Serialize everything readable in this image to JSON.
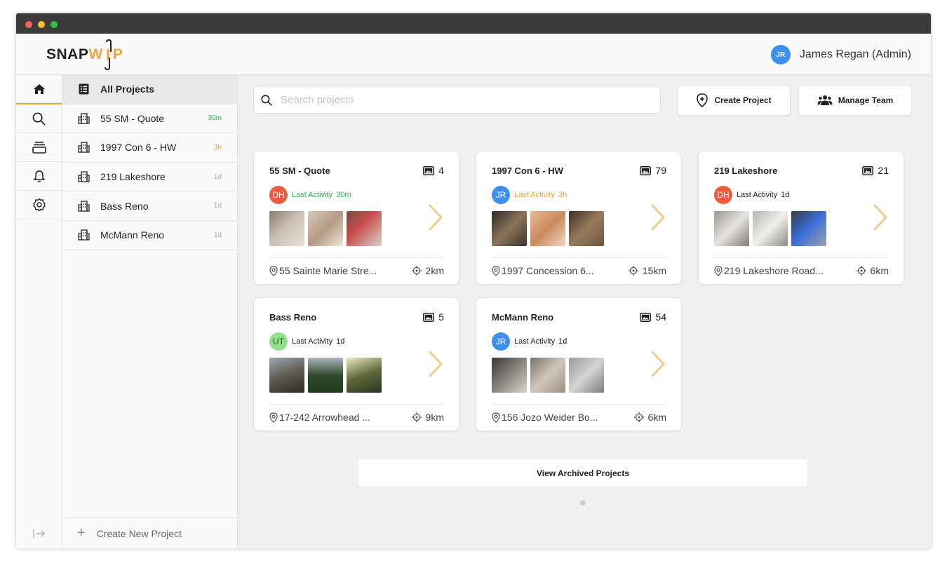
{
  "app": {
    "logo_left": "SNAP",
    "logo_right_w": "W",
    "logo_right_p": "P"
  },
  "user": {
    "initials": "JR",
    "name": "James Regan (Admin)",
    "color": "#3d8ef0"
  },
  "rail": [
    "home-icon",
    "search-icon",
    "projects-icon",
    "bell-icon",
    "settings-icon"
  ],
  "sidebar": {
    "all_projects": "All Projects",
    "items": [
      {
        "label": "55 SM - Quote",
        "time": "30m",
        "time_color": "#2db34a"
      },
      {
        "label": "1997 Con 6 - HW",
        "time": "3h",
        "time_color": "#f2a33a"
      },
      {
        "label": "219 Lakeshore",
        "time": "1d",
        "time_color": "#aaaaaa"
      },
      {
        "label": "Bass Reno",
        "time": "1d",
        "time_color": "#aaaaaa"
      },
      {
        "label": "McMann Reno",
        "time": "1d",
        "time_color": "#aaaaaa"
      }
    ],
    "create": "Create New Project"
  },
  "search": {
    "placeholder": "Search projects"
  },
  "buttons": {
    "create_project": "Create Project",
    "manage_team": "Manage Team"
  },
  "cards": [
    {
      "title": "55 SM - Quote",
      "count": "4",
      "initials": "DH",
      "avatar_color": "#ef5a3c",
      "activity_label": "Last Activity",
      "activity_time": "30m",
      "activity_color": "#2db34a",
      "address": "55 Sainte Marie Stre...",
      "distance": "2km"
    },
    {
      "title": "1997 Con 6 - HW",
      "count": "79",
      "initials": "JR",
      "avatar_color": "#3d8ef0",
      "activity_label": "Last Activity",
      "activity_time": "3h",
      "activity_color": "#f2a33a",
      "address": "1997 Concession 6...",
      "distance": "15km"
    },
    {
      "title": "219 Lakeshore",
      "count": "21",
      "initials": "DH",
      "avatar_color": "#ef5a3c",
      "activity_label": "Last Activity",
      "activity_time": "1d",
      "activity_color": "#222222",
      "address": "219 Lakeshore Road...",
      "distance": "6km"
    },
    {
      "title": "Bass Reno",
      "count": "5",
      "initials": "UT",
      "avatar_color": "#8fe08a",
      "activity_label": "Last Activity",
      "activity_time": "1d",
      "activity_color": "#222222",
      "address": "17-242 Arrowhead ...",
      "distance": "9km"
    },
    {
      "title": "McMann Reno",
      "count": "54",
      "initials": "JR",
      "avatar_color": "#3d8ef0",
      "activity_label": "Last Activity",
      "activity_time": "1d",
      "activity_color": "#222222",
      "address": "156 Jozo Weider Bo...",
      "distance": "6km"
    }
  ],
  "archived": "View Archived Projects"
}
